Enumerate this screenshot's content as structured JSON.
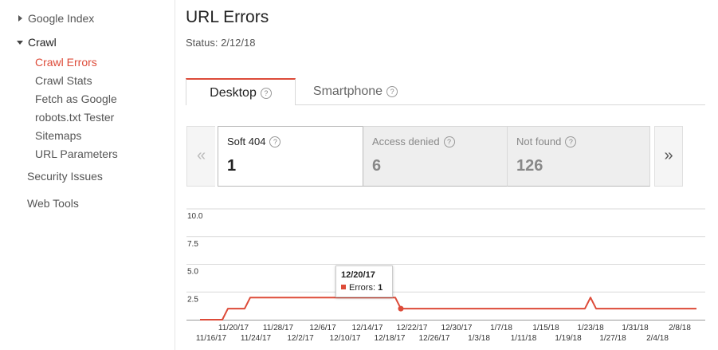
{
  "sidebar": {
    "items": [
      {
        "label": "Google Index"
      },
      {
        "label": "Crawl"
      },
      {
        "label": "Crawl Errors"
      },
      {
        "label": "Crawl Stats"
      },
      {
        "label": "Fetch as Google"
      },
      {
        "label": "robots.txt Tester"
      },
      {
        "label": "Sitemaps"
      },
      {
        "label": "URL Parameters"
      },
      {
        "label": "Security Issues"
      },
      {
        "label": "Web Tools"
      }
    ]
  },
  "main": {
    "title": "URL Errors",
    "status": "Status: 2/12/18",
    "tabs": [
      {
        "label": "Desktop",
        "selected": true
      },
      {
        "label": "Smartphone",
        "selected": false
      }
    ],
    "help_glyph": "?",
    "prev_glyph": "«",
    "next_glyph": "»",
    "cards": [
      {
        "label": "Soft 404",
        "value": "1",
        "selected": true
      },
      {
        "label": "Access denied",
        "value": "6",
        "selected": false
      },
      {
        "label": "Not found",
        "value": "126",
        "selected": false
      }
    ],
    "tooltip": {
      "date": "12/20/17",
      "series": "Errors:",
      "value": "1"
    }
  },
  "colors": {
    "accent": "#dd4b39",
    "grid": "#d9d9d9"
  },
  "chart_data": {
    "type": "line",
    "ylim": [
      0,
      10
    ],
    "yticks": [
      "10.0",
      "7.5",
      "5.0",
      "2.5"
    ],
    "xticks_upper": [
      "11/20/17",
      "11/28/17",
      "12/6/17",
      "12/14/17",
      "12/22/17",
      "12/30/17",
      "1/7/18",
      "1/15/18",
      "1/23/18",
      "1/31/18",
      "2/8/18"
    ],
    "xticks_lower": [
      "11/16/17",
      "11/24/17",
      "12/2/17",
      "12/10/17",
      "12/18/17",
      "12/26/17",
      "1/3/18",
      "1/11/18",
      "1/19/18",
      "1/27/18",
      "2/4/18"
    ],
    "series": [
      {
        "color": "#dd4b39",
        "points": [
          [
            "11/14/17",
            0
          ],
          [
            "11/18/17",
            0
          ],
          [
            "11/19/17",
            1
          ],
          [
            "11/22/17",
            1
          ],
          [
            "11/23/17",
            2
          ],
          [
            "12/18/17",
            2
          ],
          [
            "12/19/17",
            2
          ],
          [
            "12/20/17",
            1
          ],
          [
            "1/22/18",
            1
          ],
          [
            "1/23/18",
            2
          ],
          [
            "1/24/18",
            1
          ],
          [
            "2/11/18",
            1
          ]
        ],
        "highlight": [
          "12/20/17",
          1
        ]
      }
    ]
  }
}
